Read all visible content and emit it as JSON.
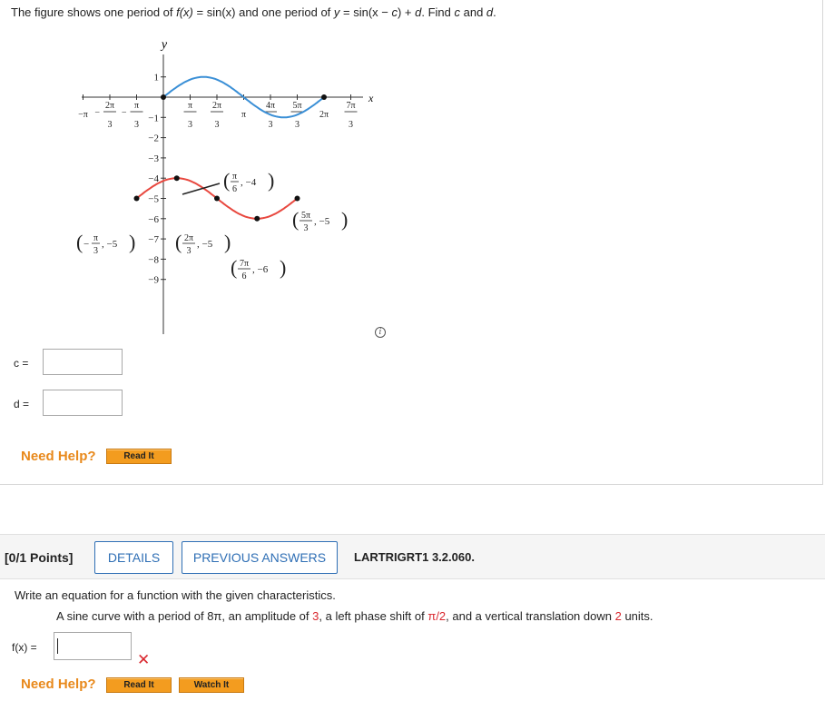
{
  "question1": {
    "text_parts": {
      "p1": "The figure shows one period of ",
      "fx": "f(x)",
      "p2": " = sin(x) and one period of ",
      "y": "y",
      "p3": " = sin(x − ",
      "c": "c",
      "p4": ") + ",
      "d": "d",
      "p5": ". Find ",
      "c2": "c",
      "p6": " and ",
      "d2": "d",
      "p7": "."
    },
    "graph": {
      "y_axis_label": "y",
      "x_axis_label": "x",
      "y_tick_labels": [
        "1",
        "−1",
        "−2",
        "−3",
        "−4",
        "−5",
        "−6",
        "−7",
        "−8",
        "−9"
      ],
      "x_tick_labels": [
        {
          "num": "−π",
          "den": ""
        },
        {
          "num": "2π",
          "den": "3",
          "neg": "−"
        },
        {
          "num": "π",
          "den": "3",
          "neg": "−"
        },
        {
          "num": "π",
          "den": "3"
        },
        {
          "num": "2π",
          "den": "3"
        },
        {
          "num": "π",
          "den": ""
        },
        {
          "num": "4π",
          "den": "3"
        },
        {
          "num": "5π",
          "den": "3"
        },
        {
          "num": "2π",
          "den": ""
        },
        {
          "num": "7π",
          "den": "3"
        }
      ],
      "point_labels": [
        {
          "num": "π",
          "den": "6",
          "neg": "",
          "y": "−4"
        },
        {
          "num": "5π",
          "den": "3",
          "neg": "",
          "y": "−5"
        },
        {
          "num": "π",
          "den": "3",
          "neg": "−",
          "y": "−5"
        },
        {
          "num": "2π",
          "den": "3",
          "neg": "",
          "y": "−5"
        },
        {
          "num": "7π",
          "den": "6",
          "neg": "",
          "y": "−6"
        }
      ],
      "colors": {
        "sin_curve": "#3a8fd6",
        "shifted_curve": "#e8483f",
        "axis": "#333333"
      }
    },
    "c_label": "c",
    "d_label": "d",
    "eq": "=",
    "c_value": "",
    "d_value": "",
    "need_help": "Need Help?",
    "read_it": "Read It"
  },
  "question2": {
    "points": "[0/1 Points]",
    "details": "DETAILS",
    "previous_answers": "PREVIOUS ANSWERS",
    "code": "LARTRIGRT1 3.2.060.",
    "prompt": "Write an equation for a function with the given characteristics.",
    "sub_parts": {
      "p1": "A sine curve with a period of 8π, an amplitude of ",
      "amp": "3",
      "p2": ", a left phase shift of ",
      "shift": "π/2",
      "p3": ", and a vertical translation down ",
      "down": "2",
      "p4": " units."
    },
    "fx_label": "f(x) =",
    "fx_value": "",
    "need_help": "Need Help?",
    "read_it": "Read It",
    "watch_it": "Watch It",
    "status": "incorrect"
  }
}
